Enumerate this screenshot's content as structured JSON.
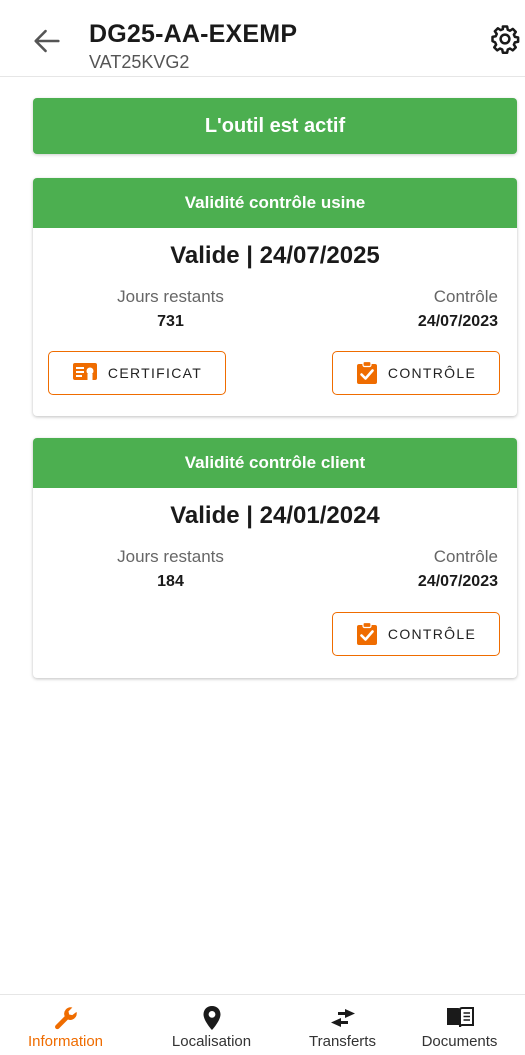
{
  "header": {
    "title": "DG25-AA-EXEMP",
    "subtitle": "VAT25KVG2",
    "back_icon": "arrow-left-icon",
    "settings_icon": "gear-icon"
  },
  "banner": {
    "text": "L'outil est actif",
    "color": "#4caf50"
  },
  "cards": [
    {
      "title": "Validité contrôle usine",
      "status": "Valide | 24/07/2025",
      "remaining_label": "Jours restants",
      "remaining_value": "731",
      "control_label": "Contrôle",
      "control_value": "24/07/2023",
      "certificate_button": "CERTIFICAT",
      "control_button": "CONTRÔLE"
    },
    {
      "title": "Validité contrôle client",
      "status": "Valide | 24/01/2024",
      "remaining_label": "Jours restants",
      "remaining_value": "184",
      "control_label": "Contrôle",
      "control_value": "24/07/2023",
      "control_button": "CONTRÔLE"
    }
  ],
  "bottom_nav": {
    "items": [
      {
        "label": "Information",
        "icon": "wrench-icon",
        "active": true
      },
      {
        "label": "Localisation",
        "icon": "location-pin-icon",
        "active": false
      },
      {
        "label": "Transferts",
        "icon": "transfer-arrows-icon",
        "active": false
      },
      {
        "label": "Documents",
        "icon": "book-icon",
        "active": false
      }
    ]
  },
  "colors": {
    "accent": "#ef6c00",
    "success": "#4caf50"
  }
}
